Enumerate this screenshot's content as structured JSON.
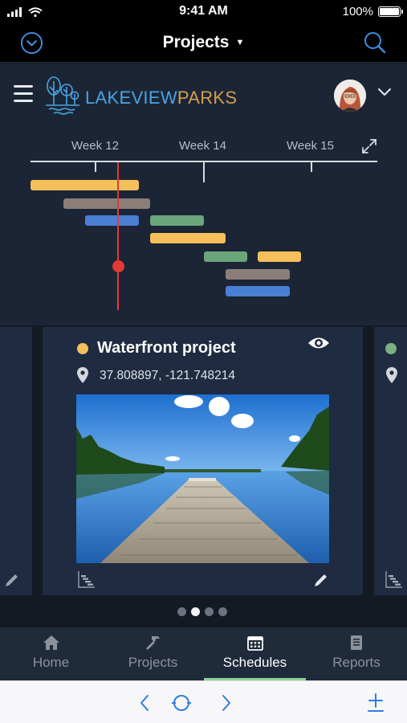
{
  "status_bar": {
    "time": "9:41 AM",
    "battery": "100%"
  },
  "nav": {
    "title": "Projects"
  },
  "header": {
    "brand_part1": "LAKEVIEW",
    "brand_part2": "PARKS",
    "brand_color1": "#4aa3e0",
    "brand_color2": "#d49f4d"
  },
  "timeline": {
    "weeks": [
      "Week 12",
      "Week 14",
      "Week 15"
    ],
    "bar_colors": {
      "yellow": "#f5bf5a",
      "taupe": "#8b7e78",
      "blue": "#4a7fd4",
      "green": "#6ba57a"
    },
    "current_marker_color": "#e53935"
  },
  "card": {
    "title": "Waterfront project",
    "coords": "37.808897, -121.748214",
    "status_color": "#f5bf5a"
  },
  "pager": {
    "pages": 4,
    "active": 2
  },
  "tabs": [
    {
      "label": "Home",
      "icon": "home-icon"
    },
    {
      "label": "Projects",
      "icon": "hammer-icon"
    },
    {
      "label": "Schedules",
      "icon": "calendar-icon"
    },
    {
      "label": "Reports",
      "icon": "document-icon"
    }
  ],
  "active_tab": "Schedules",
  "browser": {
    "icons": [
      "back-icon",
      "refresh-icon",
      "forward-icon",
      "add-icon"
    ]
  }
}
